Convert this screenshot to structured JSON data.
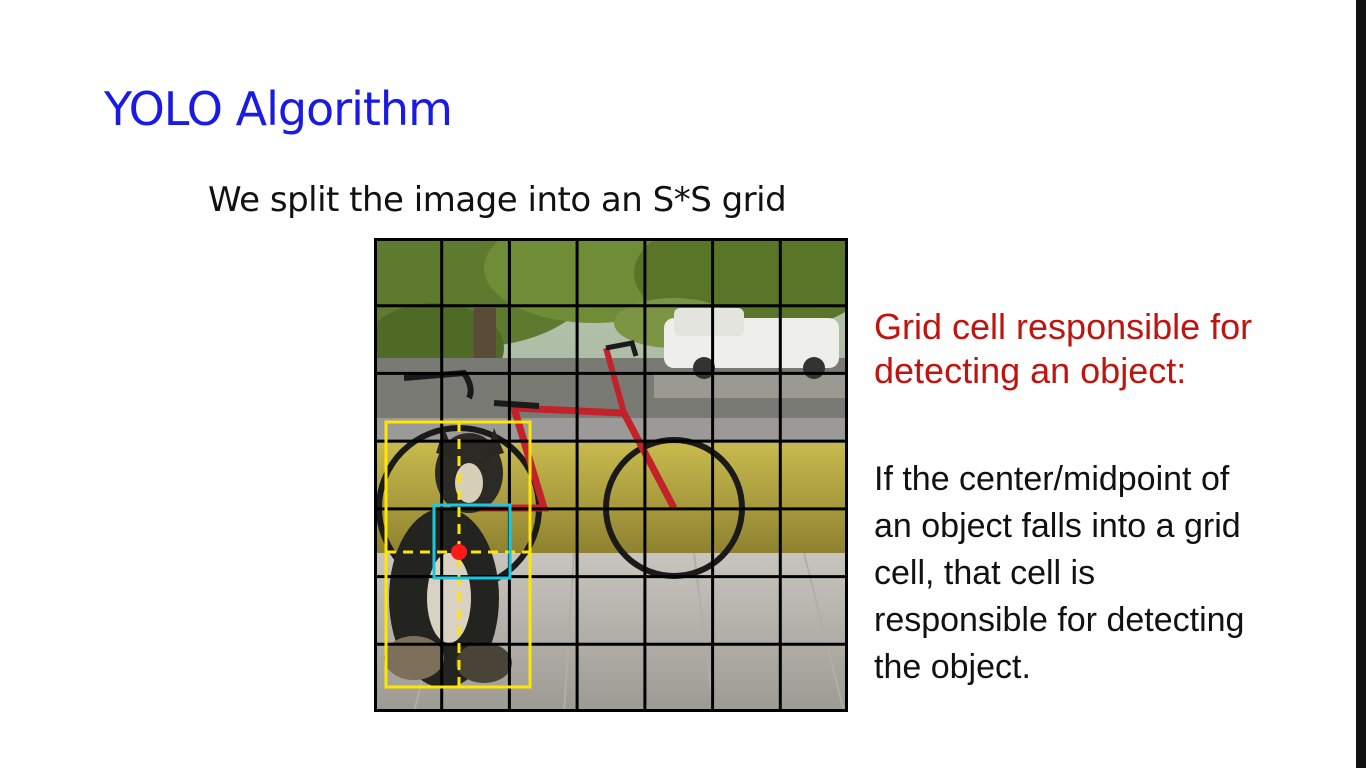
{
  "slide": {
    "title": "YOLO Algorithm",
    "subtitle": "We split the image into an S*S grid",
    "side_heading_lines": [
      "Grid cell responsible for",
      "detecting an object:"
    ],
    "side_body_lines": [
      "If the center/midpoint of",
      "an object falls into a grid",
      "cell, that cell is",
      "responsible for detecting",
      "the object."
    ]
  },
  "figure": {
    "grid_size": 7,
    "colors": {
      "title": "#1a1ae6",
      "heading": "#c0140f",
      "grid_lines": "#000000",
      "bounding_box": "#ffe600",
      "responsible_cell": "#19c8e0",
      "center_point": "#ff1a1a"
    },
    "objects_depicted": [
      "dog",
      "bicycle",
      "car",
      "tree",
      "porch"
    ]
  }
}
